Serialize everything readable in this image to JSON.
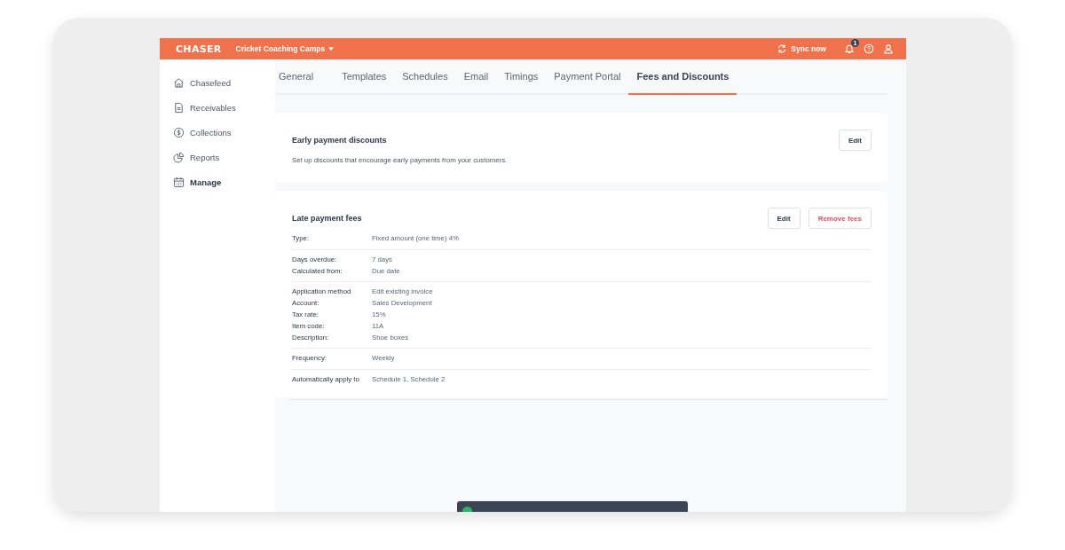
{
  "header": {
    "logo": "CHASER",
    "workspace": "Cricket Coaching Camps",
    "sync_label": "Sync now",
    "notification_count": "1"
  },
  "sidebar": {
    "items": [
      {
        "label": "Chasefeed",
        "selected": false
      },
      {
        "label": "Receivables",
        "selected": false
      },
      {
        "label": "Collections",
        "selected": false
      },
      {
        "label": "Reports",
        "selected": false
      },
      {
        "label": "Manage",
        "selected": true
      }
    ]
  },
  "tabs": [
    {
      "label": "General",
      "selected": false
    },
    {
      "label": "Templates",
      "selected": false
    },
    {
      "label": "Schedules",
      "selected": false
    },
    {
      "label": "Email",
      "selected": false
    },
    {
      "label": "Timings",
      "selected": false
    },
    {
      "label": "Payment Portal",
      "selected": false
    },
    {
      "label": "Fees and Discounts",
      "selected": true
    }
  ],
  "early_discounts": {
    "title": "Early payment discounts",
    "description": "Set up discounts that encourage early payments from your customers.",
    "buttons": [
      "Edit"
    ]
  },
  "late_fees": {
    "title": "Late payment fees",
    "buttons": [
      {
        "label": "Edit",
        "kind": "default"
      },
      {
        "label": "Remove fees",
        "kind": "danger"
      }
    ],
    "groups": [
      [
        {
          "label": "Type:",
          "value": "Fixed amount (one time) 4%"
        }
      ],
      [
        {
          "label": "Days overdue:",
          "value": "7 days"
        },
        {
          "label": "Calculated from:",
          "value": "Due date"
        }
      ],
      [
        {
          "label": "Application method",
          "value": "Edit existing invoice"
        },
        {
          "label": "Account:",
          "value": "Sales Development"
        },
        {
          "label": "Tax rate:",
          "value": "15%"
        },
        {
          "label": "Item code:",
          "value": "11A"
        },
        {
          "label": "Description:",
          "value": "Shoe boxes"
        }
      ],
      [
        {
          "label": "Frequency:",
          "value": "Weekly"
        }
      ],
      [
        {
          "label": "Automatically apply to",
          "value": "Schedule 1, Schedule 2"
        }
      ]
    ]
  }
}
